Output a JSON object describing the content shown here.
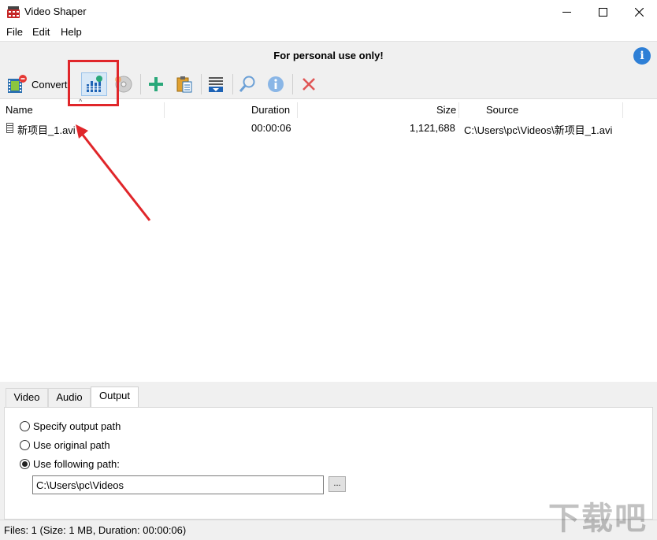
{
  "window": {
    "title": "Video Shaper"
  },
  "menu": {
    "file": "File",
    "edit": "Edit",
    "help": "Help"
  },
  "banner": {
    "text": "For personal use only!"
  },
  "toolbar": {
    "convert_label": "Convert",
    "icons": [
      "film-icon",
      "equalizer-icon",
      "disc-icon",
      "add-icon",
      "paste-icon",
      "list-icon",
      "search-icon",
      "info-icon",
      "delete-icon"
    ]
  },
  "columns": {
    "name": "Name",
    "duration": "Duration",
    "size": "Size",
    "source": "Source"
  },
  "files": [
    {
      "name": "新项目_1.avi",
      "duration": "00:00:06",
      "size": "1,121,688",
      "source": "C:\\Users\\pc\\Videos\\新项目_1.avi"
    }
  ],
  "tabs": {
    "video": "Video",
    "audio": "Audio",
    "output": "Output",
    "active": "Output"
  },
  "output": {
    "option_specify": "Specify output path",
    "option_original": "Use original path",
    "option_following": "Use following path:",
    "selected": "Use following path:",
    "path_value": "C:\\Users\\pc\\Videos",
    "browse_label": "..."
  },
  "status": {
    "text": "Files: 1 (Size: 1 MB, Duration: 00:00:06)"
  },
  "watermark": {
    "text": "下载吧"
  },
  "colors": {
    "annotation": "#e0262a",
    "info_blue": "#2e7fd6",
    "add_green": "#2aa87a",
    "delete_red": "#e05555"
  }
}
